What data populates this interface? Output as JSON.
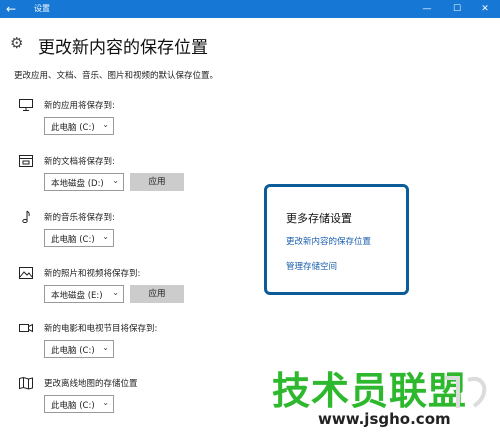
{
  "window": {
    "title": "设置",
    "back_icon": "←",
    "min_icon": "—",
    "max_icon": "☐",
    "close_icon": "✕"
  },
  "page": {
    "gear_icon": "⚙",
    "title": "更改新内容的保存位置",
    "description": "更改应用、文档、音乐、图片和视频的默认保存位置。"
  },
  "rows": [
    {
      "icon": "monitor",
      "label": "新的应用将保存到:",
      "select": "此电脑 (C:)"
    },
    {
      "icon": "document",
      "label": "新的文档将保存到:",
      "select": "本地磁盘 (D:)",
      "apply": "应用"
    },
    {
      "icon": "music",
      "label": "新的音乐将保存到:",
      "select": "此电脑 (C:)"
    },
    {
      "icon": "picture",
      "label": "新的照片和视频将保存到:",
      "select": "本地磁盘 (E:)",
      "apply": "应用"
    },
    {
      "icon": "video",
      "label": "新的电影和电视节目将保存到:",
      "select": "此电脑 (C:)"
    },
    {
      "icon": "map",
      "label": "更改离线地图的存储位置",
      "select": "此电脑 (C:)"
    }
  ],
  "chevron": "⌄",
  "more": {
    "title": "更多存储设置",
    "link1": "更改新内容的保存位置",
    "link2": "管理存储空间"
  },
  "watermark": {
    "text": "技术员联盟",
    "url": "www.jsgho.com"
  },
  "colors": {
    "accent": "#1678d4",
    "link": "#1b5fae",
    "highlight_border": "#0b5c99",
    "watermark_green": "#2eb82e"
  }
}
